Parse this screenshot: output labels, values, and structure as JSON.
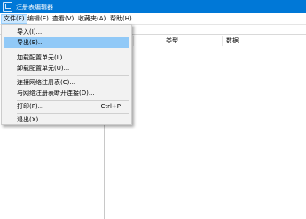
{
  "window": {
    "title": "注册表编辑器"
  },
  "menubar": {
    "items": [
      {
        "label": "文件(F)"
      },
      {
        "label": "编辑(E)"
      },
      {
        "label": "查看(V)"
      },
      {
        "label": "收藏夹(A)"
      },
      {
        "label": "帮助(H)"
      }
    ]
  },
  "columns": {
    "type": "类型",
    "data": "数据"
  },
  "file_menu": {
    "items": [
      {
        "label": "导入(I)..."
      },
      {
        "label": "导出(E)..."
      },
      {
        "label": "加载配置单元(L)..."
      },
      {
        "label": "卸载配置单元(U)..."
      },
      {
        "label": "连接网络注册表(C)..."
      },
      {
        "label": "与网络注册表断开连接(D)..."
      },
      {
        "label": "打印(P)...",
        "shortcut": "Ctrl+P"
      },
      {
        "label": "退出(X)"
      }
    ]
  },
  "colors": {
    "titlebar": "#0078d7",
    "menu_highlight": "#91c9f7",
    "menubar_active": "#cce8ff"
  }
}
